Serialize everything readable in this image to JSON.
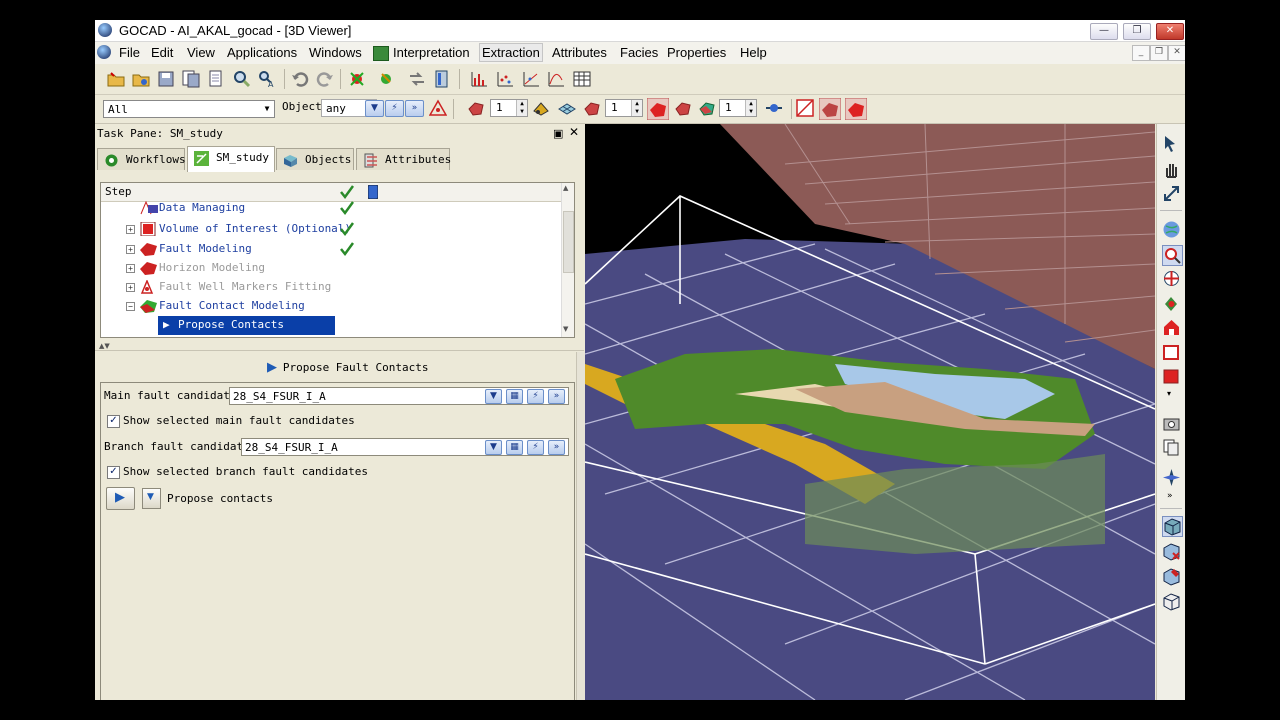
{
  "window": {
    "title": "GOCAD - AI_AKAL_gocad - [3D Viewer]"
  },
  "window_controls": {
    "minimize": "—",
    "restore": "❐",
    "close": "✕"
  },
  "menu": {
    "items": [
      "File",
      "Edit",
      "View",
      "Applications",
      "Windows",
      "Interpretation",
      "Extraction",
      "Attributes",
      "Facies",
      "Properties",
      "Help"
    ],
    "active": "Extraction"
  },
  "toolbar2": {
    "filter_value": "All",
    "object_label": "Object",
    "object_value": "any",
    "spin_values": [
      "1",
      "1",
      "1"
    ]
  },
  "task_pane": {
    "title": "Task Pane: SM_study"
  },
  "tabs": [
    "Workflows",
    "SM_study",
    "Objects",
    "Attributes"
  ],
  "tree": {
    "header": "Step",
    "rows": [
      {
        "label": "Data Managing",
        "state": "done"
      },
      {
        "label": "Volume of Interest (Optional)",
        "state": "done"
      },
      {
        "label": "Fault Modeling",
        "state": "done"
      },
      {
        "label": "Horizon Modeling",
        "state": "disabled"
      },
      {
        "label": "Fault Well Markers Fitting",
        "state": "disabled"
      },
      {
        "label": "Fault Contact Modeling",
        "state": "active"
      },
      {
        "label": "Propose Contacts",
        "state": "selected"
      }
    ]
  },
  "form": {
    "title": "Propose Fault Contacts",
    "main_label": "Main fault candidates",
    "main_value": "28_S4_FSUR_I_A",
    "show_main": "Show selected main fault candidates",
    "branch_label": "Branch fault candidates",
    "branch_value": "28_S4_FSUR_I_A",
    "show_branch": "Show selected branch fault candidates",
    "run_label": "Propose contacts"
  },
  "colors": {
    "seafloor": "#4a4a82",
    "fault_wall": "#8c5a56",
    "green_fault": "#4f8a2a",
    "selection": "#0a3fa8"
  }
}
